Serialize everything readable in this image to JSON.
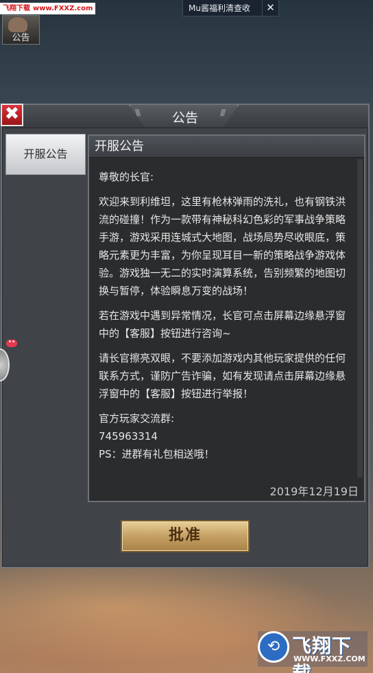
{
  "watermark_top": {
    "brand": "飞翔下载",
    "url": "www.FXXZ.com"
  },
  "notice_button": {
    "label": "公告"
  },
  "toast": {
    "text": "Mu酱福利清查收",
    "close_symbol": "✕"
  },
  "dialog": {
    "title": "公告",
    "close_symbol": "✖",
    "tabs": [
      {
        "label": "开服公告"
      }
    ],
    "panel": {
      "header": "开服公告",
      "paragraphs": [
        "尊敬的长官:",
        "欢迎来到利维坦，这里有枪林弹雨的洗礼，也有钢铁洪流的碰撞！作为一款带有神秘科幻色彩的军事战争策略手游，游戏采用连城式大地图，战场局势尽收眼底，策略元素更为丰富，为你呈现耳目一新的策略战争游戏体验。游戏独一无二的实时演算系统，告别频繁的地图切换与暂停，体验瞬息万变的战场！",
        "若在游戏中遇到异常情况，长官可点击屏幕边缘悬浮窗中的【客服】按钮进行咨询~",
        "请长官擦亮双眼，不要添加游戏内其他玩家提供的任何联系方式，谨防广告诈骗，如有发现请点击屏幕边缘悬浮窗中的【客服】按钮进行举报！",
        "官方玩家交流群:",
        "745963314",
        "PS：进群有礼包相送哦！"
      ],
      "date": "2019年12月19日"
    },
    "approve_label": "批准"
  },
  "float_badge": "••",
  "watermark_logo": {
    "brand": "飞翔下载",
    "url": "WWW.FXXZ.COM"
  },
  "colors": {
    "close_red": "#c41f26",
    "approve_gold": "#c8a468",
    "panel_bg": "#2b2c2e"
  }
}
